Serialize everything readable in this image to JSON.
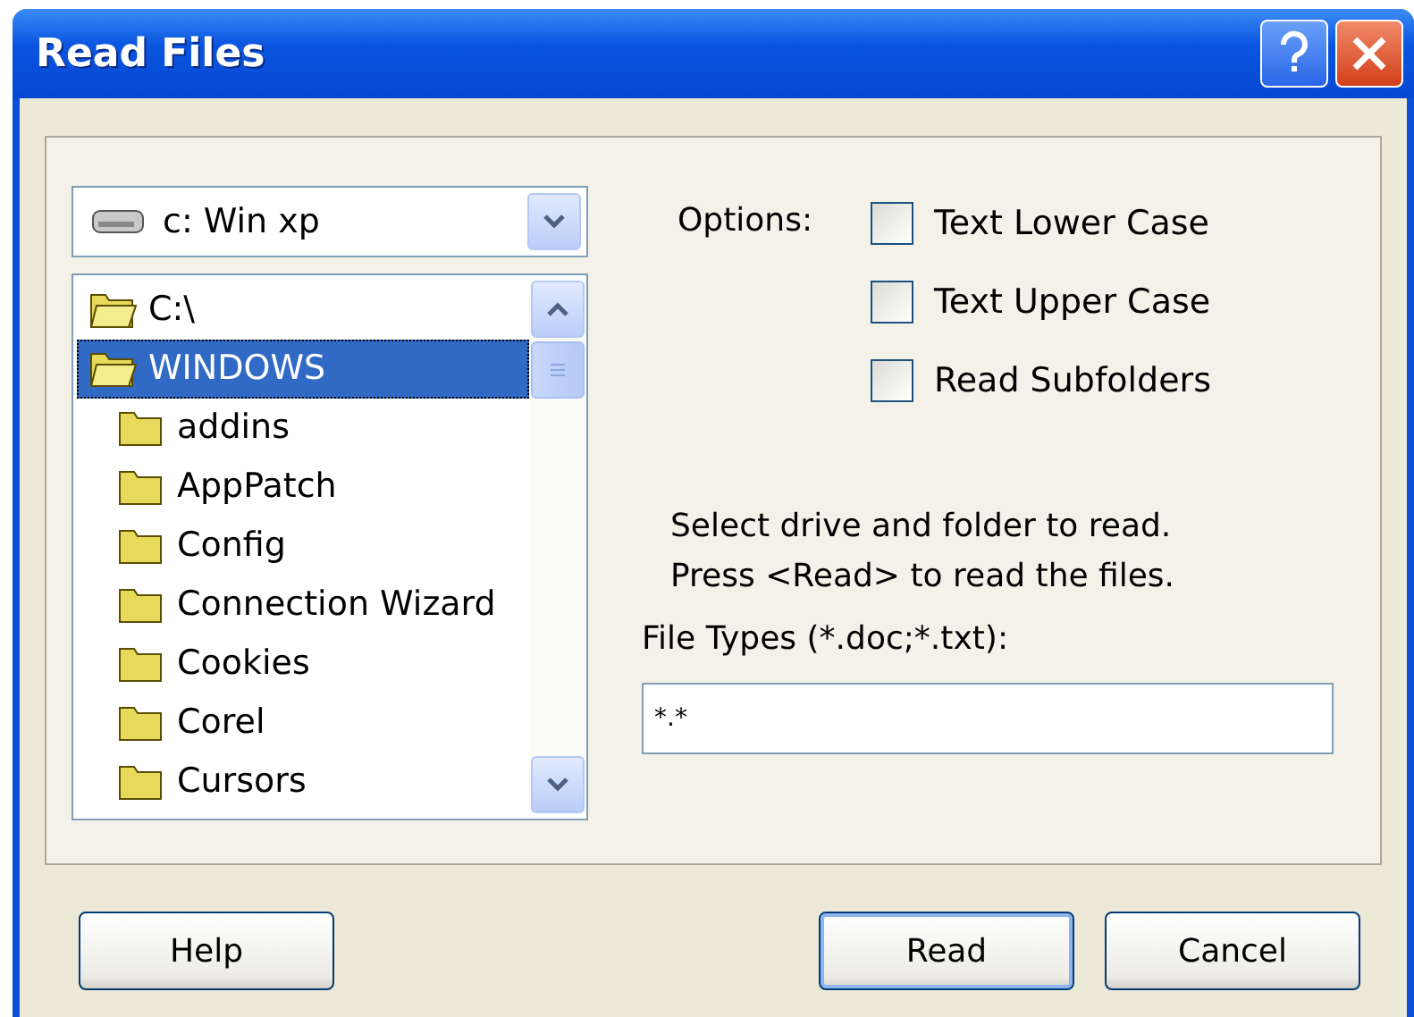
{
  "window": {
    "title": "Read Files"
  },
  "drive": {
    "value": "c: Win xp"
  },
  "folders": [
    {
      "name": "C:\\",
      "open": true,
      "selected": false,
      "children": [
        {
          "name": "WINDOWS",
          "open": true,
          "selected": true,
          "children": [
            {
              "name": "addins",
              "open": false,
              "selected": false
            },
            {
              "name": "AppPatch",
              "open": false,
              "selected": false
            },
            {
              "name": "Config",
              "open": false,
              "selected": false
            },
            {
              "name": "Connection Wizard",
              "open": false,
              "selected": false
            },
            {
              "name": "Cookies",
              "open": false,
              "selected": false
            },
            {
              "name": "Corel",
              "open": false,
              "selected": false
            },
            {
              "name": "Cursors",
              "open": false,
              "selected": false
            }
          ]
        }
      ]
    }
  ],
  "options": {
    "label": "Options:",
    "items": [
      {
        "label": "Text Lower Case",
        "checked": false
      },
      {
        "label": "Text Upper Case",
        "checked": false
      },
      {
        "label": "Read Subfolders",
        "checked": false
      }
    ]
  },
  "info": [
    "Select drive and folder to read.",
    "Press <Read> to read the files."
  ],
  "file_types": {
    "label": "File Types (*.doc;*.txt):",
    "value": "*.*"
  },
  "buttons": [
    {
      "label": "Help",
      "default": false
    },
    {
      "label": "Read",
      "default": true
    },
    {
      "label": "Cancel",
      "default": false
    }
  ]
}
